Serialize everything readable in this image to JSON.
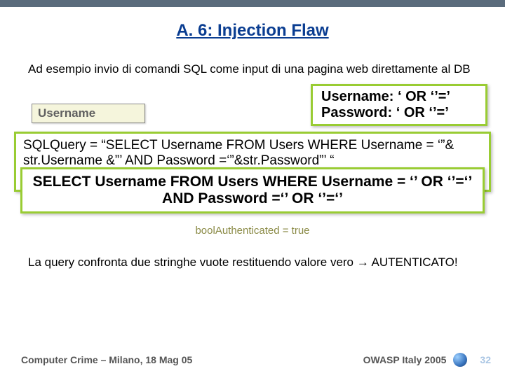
{
  "title": "A. 6: Injection Flaw",
  "intro": "Ad esempio invio di comandi SQL come input di una pagina web direttamente al DB",
  "username_label": "Username",
  "payload": {
    "line1": "Username: ‘ OR ‘’=’",
    "line2": "Password:  ‘ OR ‘’=’"
  },
  "sql_box": {
    "line1": "SQLQuery = “SELECT Username FROM Users WHERE Username = ‘”& str.Username &”’ AND Password =‘”&str.Password”’ “",
    "faded": "boolAuthenticated = true"
  },
  "resulting_query": "SELECT Username FROM Users WHERE Username = ‘’ OR ‘’=‘’ AND Password =‘’ OR ‘’=‘’",
  "conclusion": "La query confronta due stringhe vuote restituendo valore vero → AUTENTICATO!",
  "footer": {
    "left": "Computer Crime – Milano, 18 Mag 05",
    "right": "OWASP Italy 2005",
    "page": "32"
  }
}
